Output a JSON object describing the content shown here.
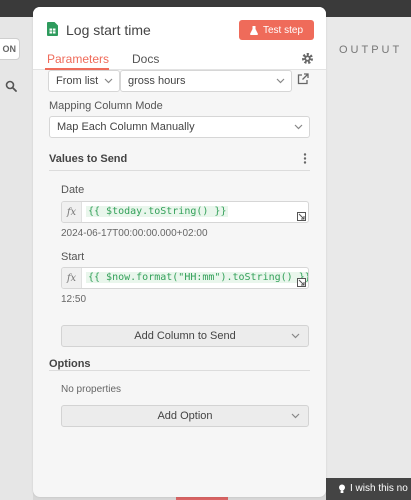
{
  "background": {
    "left_pill_text": "ON",
    "output_label": "OUTPUT",
    "footer_text": "I wish this no"
  },
  "panel": {
    "title": "Log start time",
    "test_button": "Test step",
    "tabs": [
      {
        "label": "Parameters",
        "active": true
      },
      {
        "label": "Docs",
        "active": false
      }
    ]
  },
  "sheet": {
    "mode": "From list",
    "value": "gross hours"
  },
  "mapping": {
    "label": "Mapping Column Mode",
    "value": "Map Each Column Manually"
  },
  "values_section": {
    "title": "Values to Send",
    "fields": [
      {
        "label": "Date",
        "expression": "{{ $today.toString() }}",
        "result": "2024-06-17T00:00:00.000+02:00"
      },
      {
        "label": "Start",
        "expression": "{{ $now.format(\"HH:mm\").toString() }}",
        "result": "12:50"
      }
    ],
    "add_button": "Add Column to Send"
  },
  "options_section": {
    "title": "Options",
    "empty_text": "No properties",
    "add_button": "Add Option"
  },
  "colors": {
    "accent": "#ef6b5a",
    "expression_green": "#34a15a",
    "doc_icon_green": "#2e9b5d"
  },
  "icons": {
    "doc": "sheet-doc-icon",
    "flask": "flask-icon",
    "gear": "gear-icon",
    "external": "external-link-icon",
    "kebab": "kebab-menu-icon",
    "search": "search-icon",
    "expand": "expand-icon",
    "bulb": "lightbulb-icon"
  }
}
